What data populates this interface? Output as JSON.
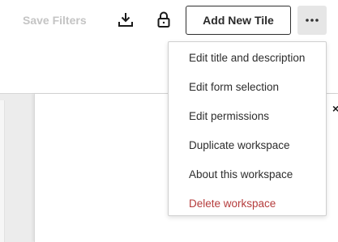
{
  "toolbar": {
    "save_filters_label": "Save Filters",
    "download_icon": "download-icon",
    "lock_icon": "lock-icon",
    "add_tile_label": "Add New Tile",
    "more_icon": "more-horizontal-icon"
  },
  "panel": {
    "close_glyph": "×"
  },
  "menu": {
    "items": [
      {
        "label": "Edit title and description",
        "type": "normal"
      },
      {
        "label": "Edit form selection",
        "type": "normal"
      },
      {
        "label": "Edit permissions",
        "type": "normal"
      },
      {
        "label": "Duplicate workspace",
        "type": "normal"
      },
      {
        "label": "About this workspace",
        "type": "normal"
      },
      {
        "label": "Delete workspace",
        "type": "danger"
      }
    ]
  },
  "colors": {
    "disabled_text": "#c4c4c4",
    "danger": "#b53c3c",
    "menu_text": "#2d2d2d",
    "more_button_bg": "#e6e6e6"
  }
}
